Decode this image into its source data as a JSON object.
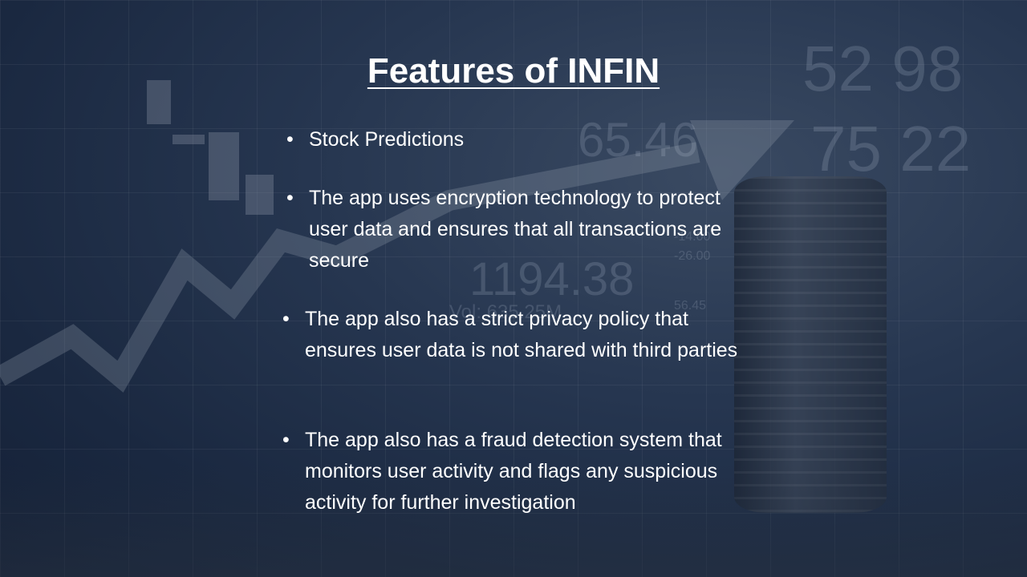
{
  "slide": {
    "title": "Features of INFIN",
    "bullets": [
      "Stock Predictions",
      "The app uses encryption technology to protect user data and ensures that all transactions are secure",
      "The app also has a strict privacy policy that ensures user data is not shared with third parties",
      "The app also has a fraud detection system that monitors user activity and flags any suspicious activity for further investigation"
    ],
    "bullet_glyph": "•"
  },
  "background": {
    "numbers": [
      "52 98",
      "75 22",
      "65.46",
      "1194.38",
      "-14.00",
      "-26.00",
      "Vol: 635.25M",
      "56.45"
    ]
  }
}
